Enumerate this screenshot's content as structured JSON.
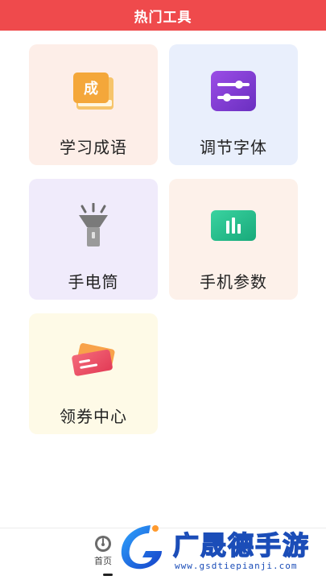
{
  "header": {
    "title": "热门工具"
  },
  "tools": [
    {
      "label": "学习成语",
      "icon_text": "成"
    },
    {
      "label": "调节字体"
    },
    {
      "label": "手电筒"
    },
    {
      "label": "手机参数"
    },
    {
      "label": "领券中心"
    }
  ],
  "bottom_nav": {
    "home_label": "首页"
  },
  "watermark": {
    "text": "广晟德手游",
    "url": "www.gsdtiepianji.com"
  },
  "colors": {
    "header": "#ef4a4c",
    "watermark": "#1b4db8"
  }
}
